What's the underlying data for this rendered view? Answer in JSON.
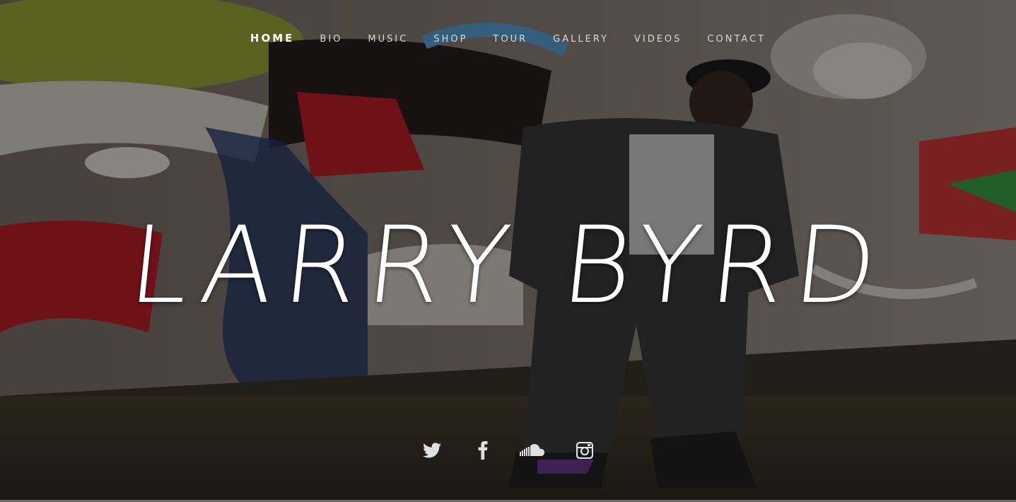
{
  "site": {
    "title": "LARRY BYRD"
  },
  "nav": {
    "items": [
      {
        "label": "HOME",
        "active": true
      },
      {
        "label": "BIO"
      },
      {
        "label": "MUSIC"
      },
      {
        "label": "SHOP"
      },
      {
        "label": "TOUR"
      },
      {
        "label": "GALLERY"
      },
      {
        "label": "VIDEOS"
      },
      {
        "label": "CONTACT"
      }
    ]
  },
  "social": {
    "icons": [
      "twitter-icon",
      "facebook-icon",
      "soundcloud-icon",
      "instagram-icon"
    ]
  },
  "colors": {
    "text": "#ffffff",
    "nav_text": "#d8d8d8",
    "icon": "#e0e0e0"
  }
}
